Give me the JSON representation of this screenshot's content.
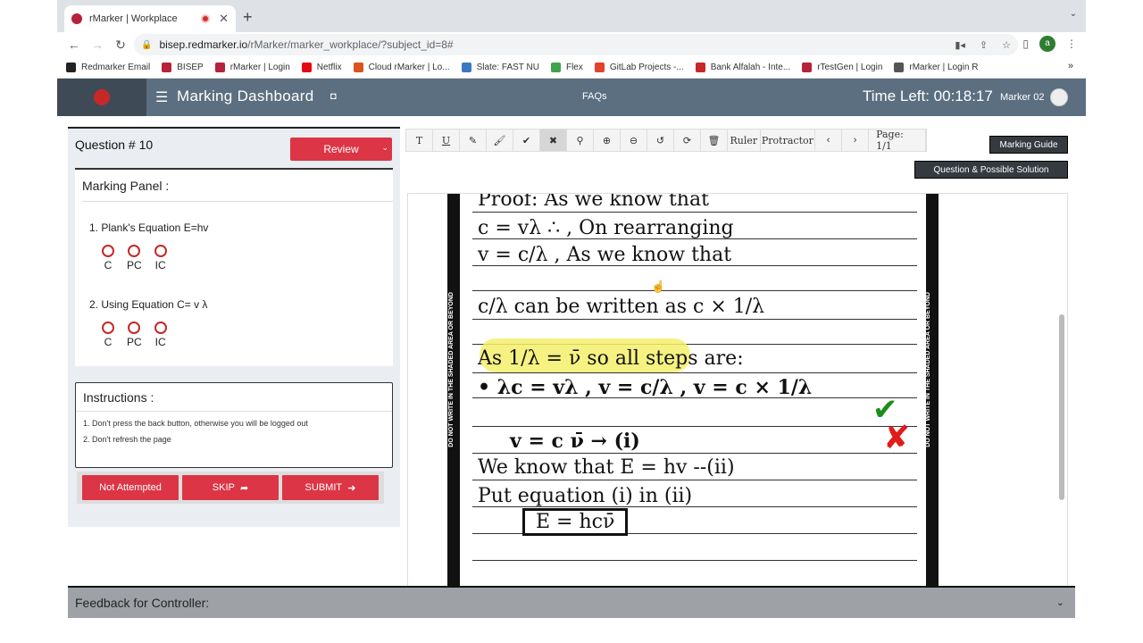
{
  "browser": {
    "tab_title": "rMarker | Workplace",
    "new_tab": "+",
    "tab_menu": "⌄",
    "url_host": "bisep.redmarker.io",
    "url_path": "/rMarker/marker_workplace/?subject_id=8#",
    "profile_initial": "a"
  },
  "bookmarks": [
    {
      "label": "Redmarker Email",
      "color": "#222"
    },
    {
      "label": "BISEP",
      "color": "#b5223a"
    },
    {
      "label": "rMarker | Login",
      "color": "#b5223a"
    },
    {
      "label": "Netflix",
      "color": "#e50914"
    },
    {
      "label": "Cloud rMarker | Lo...",
      "color": "#d9541e"
    },
    {
      "label": "Slate: FAST NU",
      "color": "#3a78c2"
    },
    {
      "label": "Flex",
      "color": "#3fa34d"
    },
    {
      "label": "GitLab Projects -...",
      "color": "#e24329"
    },
    {
      "label": "Bank Alfalah - Inte...",
      "color": "#c62828"
    },
    {
      "label": "rTestGen | Login",
      "color": "#b5223a"
    },
    {
      "label": "rMarker | Login R",
      "color": "#555"
    }
  ],
  "bookmarks_more": "»",
  "header": {
    "title": "Marking Dashboard",
    "faqs": "FAQs",
    "time_left": "Time Left: 00:18:17",
    "marker": "Marker 02"
  },
  "question": {
    "number": "Question # 10",
    "review_label": "Review"
  },
  "marking_panel": {
    "title": "Marking Panel :",
    "criteria": [
      {
        "label": "1. Plank's Equation E=hv",
        "options": [
          "C",
          "PC",
          "IC"
        ]
      },
      {
        "label": "2. Using Equation C= v λ",
        "options": [
          "C",
          "PC",
          "IC"
        ]
      }
    ]
  },
  "instructions": {
    "title": "Instructions :",
    "items": [
      {
        "num": "1.",
        "text": "Don't press the back button, otherwise you will be logged out"
      },
      {
        "num": "2.",
        "text": "Don't refresh the page"
      }
    ]
  },
  "actions": {
    "not_attempted": "Not Attempted",
    "skip": "SKIP",
    "submit": "SUBMIT"
  },
  "toolbar": {
    "text_tool": "T",
    "underline_tool": "U",
    "ruler": "Ruler",
    "protractor": "Protractor",
    "page": "Page: 1/1",
    "icons": [
      "pencil-icon",
      "brush-icon",
      "check-icon",
      "cross-icon",
      "search-icon",
      "zoom-in-icon",
      "zoom-out-icon",
      "undo-icon",
      "refresh-icon",
      "delete-icon"
    ]
  },
  "marking_guide": "Marking Guide",
  "question_solution": "Question & Possible Solution",
  "answer_sheet": {
    "margin_text": "DO NOT WRITE IN THE SHADED AREA OR BEYOND",
    "lines": [
      "Proof: As we know that",
      "c = vλ ∴ , On rearranging",
      "v = c/λ , As we know that",
      "c/λ can be written as c × 1/λ",
      "As 1/λ = ν̄ so all steps are:",
      "• λc = vλ , v = c/λ , v = c × 1/λ",
      "v = c ν̄ → (i)",
      "We know that E = hv --(ii)",
      "Put equation (i) in (ii)",
      "E = hcν̄"
    ]
  },
  "feedback": {
    "title": "Feedback for Controller:"
  },
  "colors": {
    "header": "#5c6f80",
    "accent_red": "#dc3545",
    "dark_button": "#343a40",
    "highlight": "#f3f06c",
    "tick": "#1b8f1b",
    "cross": "#e21b1b"
  }
}
